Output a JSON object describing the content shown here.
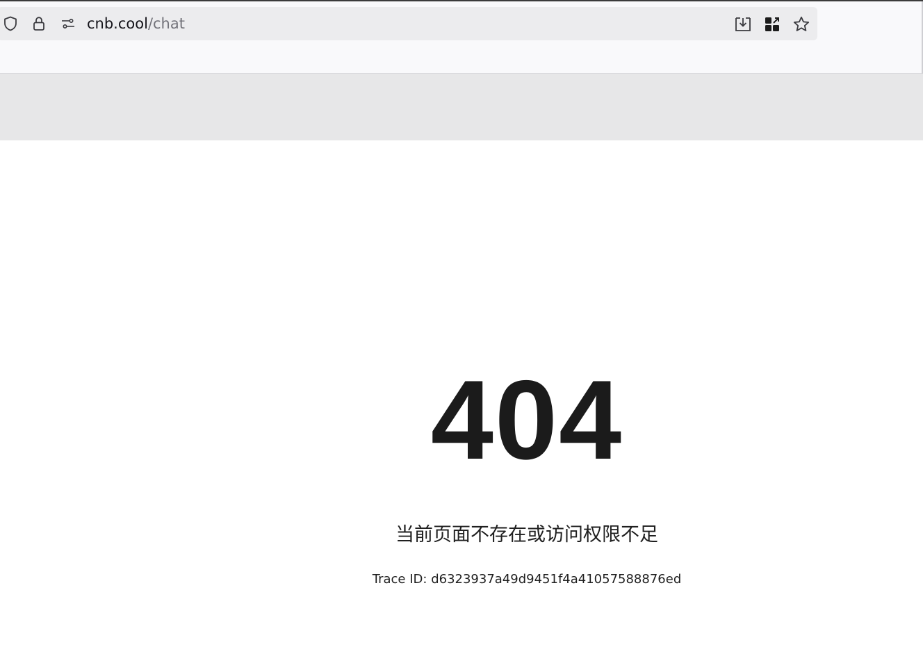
{
  "browser": {
    "url_host": "cnb.cool",
    "url_path": "/chat",
    "icons": {
      "shield": "shield-icon",
      "lock": "lock-icon",
      "permissions": "permissions-icon",
      "download": "download-icon",
      "extensions": "extensions-icon",
      "bookmark": "star-icon"
    }
  },
  "error": {
    "code": "404",
    "message": "当前页面不存在或访问权限不足",
    "trace_label": "Trace ID: ",
    "trace_id": "d6323937a49d9451f4a41057588876ed"
  },
  "colors": {
    "text": "#1b1b1b",
    "toolbar": "#f9f9fb",
    "urlbar": "#ececee",
    "banner": "#e7e7e8",
    "url_path": "#73737a"
  }
}
